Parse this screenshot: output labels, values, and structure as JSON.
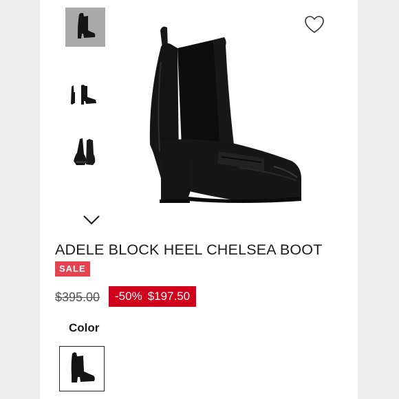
{
  "product": {
    "title": "ADELE BLOCK HEEL CHELSEA BOOT",
    "badge": "SALE",
    "original_price": "$395.00",
    "discount": "-50%",
    "sale_price": "$197.50"
  },
  "color_section": {
    "label": "Color"
  },
  "icons": {
    "favorite": "heart-outline-icon",
    "gallery_next": "chevron-down-icon"
  },
  "colors": {
    "sale_badge": "#e4434f",
    "price_box": "#d0021b",
    "page_background": "#ececec",
    "boot": "#141414"
  }
}
